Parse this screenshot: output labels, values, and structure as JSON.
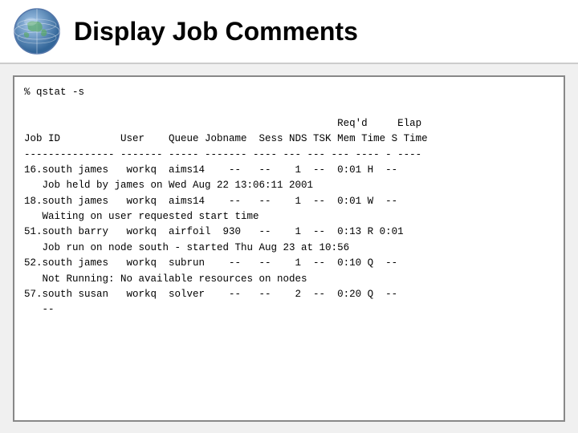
{
  "header": {
    "title": "Display Job Comments"
  },
  "terminal": {
    "lines": [
      "% qstat -s",
      "",
      "                                                    Req'd     Elap",
      "Job ID          User    Queue Jobname  Sess NDS TSK Mem Time S Time",
      "--------------- ------- ----- ------- ---- --- --- --- ---- - ----",
      "16.south james   workq  aims14    --   --    1  --  0:01 H  --",
      "   Job held by james on Wed Aug 22 13:06:11 2001",
      "18.south james   workq  aims14    --   --    1  --  0:01 W  --",
      "   Waiting on user requested start time",
      "51.south barry   workq  airfoil  930   --    1  --  0:13 R 0:01",
      "   Job run on node south - started Thu Aug 23 at 10:56",
      "52.south james   workq  subrun    --   --    1  --  0:10 Q  --",
      "   Not Running: No available resources on nodes",
      "57.south susan   workq  solver    --   --    2  --  0:20 Q  --",
      "   --"
    ]
  }
}
